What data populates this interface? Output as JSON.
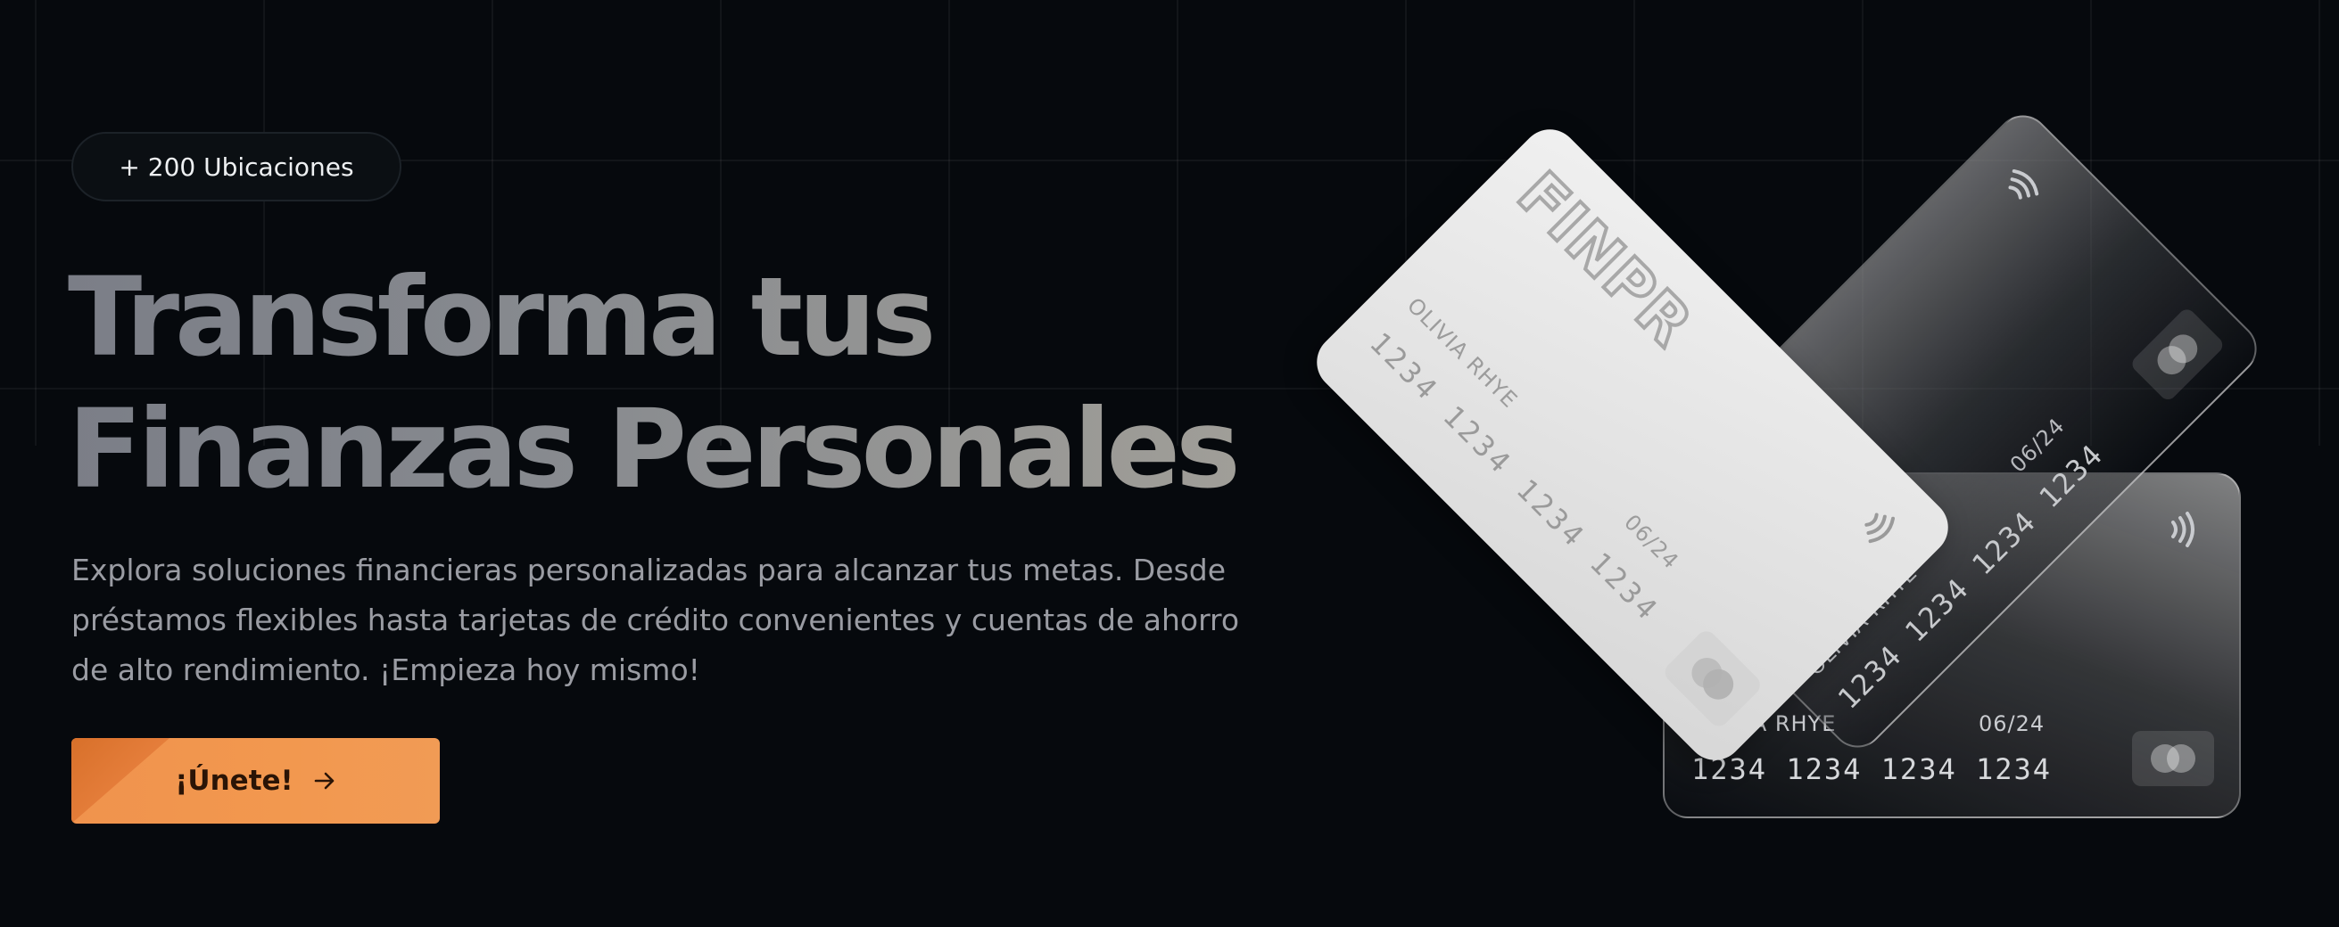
{
  "badge": {
    "text": "+ 200 Ubicaciones"
  },
  "hero": {
    "title_line1": "Transforma tus",
    "title_line2": "Finanzas Personales",
    "description": "Explora soluciones financieras personalizadas para alcanzar tus metas. Desde préstamos flexibles hasta tarjetas de crédito convenientes y cuentas de ahorro de alto rendimiento. ¡Empieza hoy mismo!"
  },
  "cta": {
    "label": "¡Únete!",
    "icon": "arrow-right-icon"
  },
  "cards": [
    {
      "logo": "FINPRO",
      "holder": "OLIVIA RHYE",
      "number": "1234 1234 1234 1234",
      "expiry": "06/24"
    },
    {
      "holder": "OLIVIA RHYE",
      "number": "1234 1234 1234 1234",
      "expiry": "06/24"
    },
    {
      "holder": "OLIVIA RHYE",
      "number": "1234 1234 1234 1234",
      "expiry": "06/24"
    }
  ],
  "colors": {
    "background": "#06090d",
    "accent": "#f0934d",
    "headline_start": "#7b7e87",
    "headline_end": "#a09e98"
  }
}
